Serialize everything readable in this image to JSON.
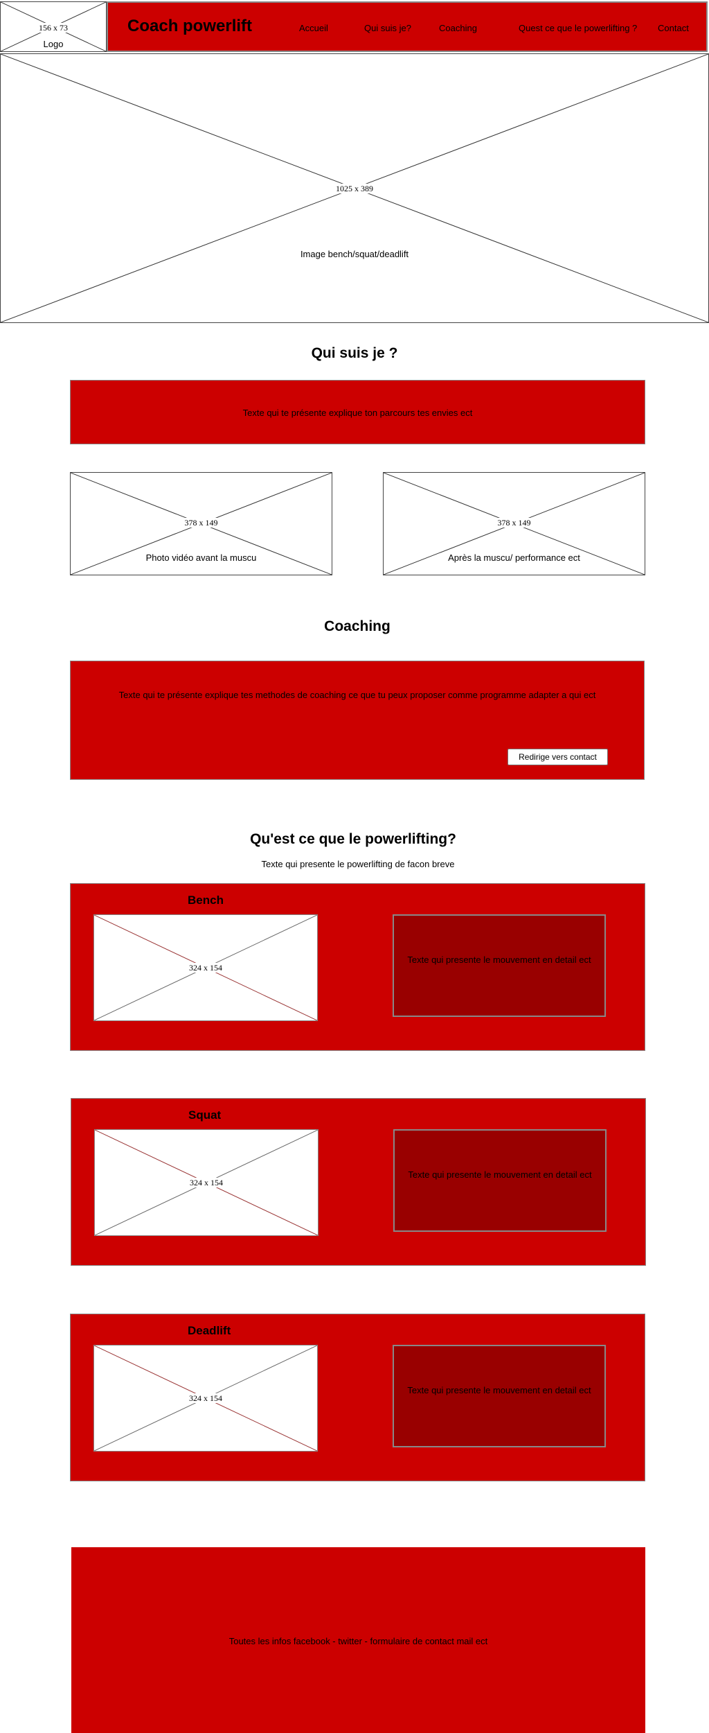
{
  "header": {
    "logo": {
      "dimensions": "156 x 73",
      "label": "Logo"
    },
    "site_title": "Coach powerlift",
    "nav": [
      {
        "label": "Accueil"
      },
      {
        "label": "Qui suis je?"
      },
      {
        "label": "Coaching"
      },
      {
        "label": "Quest ce que le powerlifting ?"
      },
      {
        "label": "Contact"
      }
    ]
  },
  "hero": {
    "dimensions": "1025 x 389",
    "caption": "Image bench/squat/deadlift"
  },
  "about": {
    "heading": "Qui suis je ?",
    "text": "Texte qui te présente explique ton parcours tes envies ect",
    "images": [
      {
        "dimensions": "378 x 149",
        "caption": "Photo vidéo avant la muscu"
      },
      {
        "dimensions": "378 x 149",
        "caption": "Après la muscu/ performance ect"
      }
    ]
  },
  "coaching": {
    "heading": "Coaching",
    "text": "Texte qui te présente explique tes methodes de coaching ce que tu peux proposer comme programme adapter a qui ect",
    "button": "Redirige vers contact"
  },
  "powerlifting": {
    "heading": "Qu'est ce que le powerlifting?",
    "intro": "Texte qui presente le powerlifting de facon breve",
    "cards": [
      {
        "title": "Bench",
        "image_dimensions": "324 x 154",
        "text": "Texte qui presente le mouvement en detail ect"
      },
      {
        "title": "Squat",
        "image_dimensions": "324 x 154",
        "text": "Texte qui presente le mouvement en detail ect"
      },
      {
        "title": "Deadlift",
        "image_dimensions": "324 x 154",
        "text": "Texte qui presente le mouvement en detail ect"
      }
    ]
  },
  "footer": {
    "text": "Toutes les infos facebook - twitter - formulaire de contact mail ect"
  },
  "colors": {
    "brand_red": "#cc0000",
    "dark_red": "#990000"
  }
}
